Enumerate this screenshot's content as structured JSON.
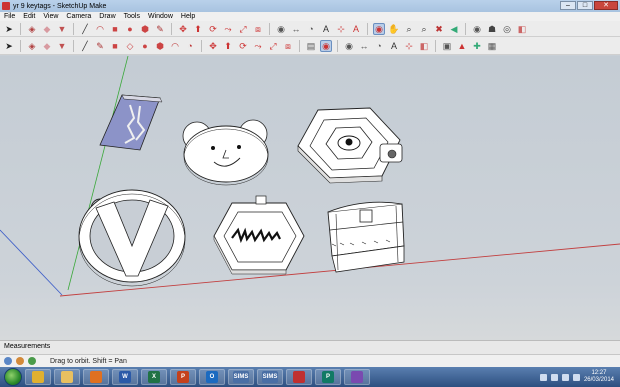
{
  "window": {
    "title": "yr 9 keytags - SketchUp Make"
  },
  "menu": [
    "File",
    "Edit",
    "View",
    "Camera",
    "Draw",
    "Tools",
    "Window",
    "Help"
  ],
  "toolbar1": [
    {
      "icon": "select-arrow-icon",
      "glyph": "➤",
      "color": "#222"
    },
    {
      "icon": "sep"
    },
    {
      "icon": "component-icon",
      "glyph": "◈",
      "color": "#b04040"
    },
    {
      "icon": "eraser-icon",
      "glyph": "◆",
      "color": "#d89aa0"
    },
    {
      "icon": "paint-bucket-icon",
      "glyph": "▼",
      "color": "#c05050"
    },
    {
      "icon": "sep"
    },
    {
      "icon": "line-icon",
      "glyph": "╱",
      "color": "#333"
    },
    {
      "icon": "arc-icon",
      "glyph": "◠",
      "color": "#b33"
    },
    {
      "icon": "rectangle-icon",
      "glyph": "■",
      "color": "#c44"
    },
    {
      "icon": "circle-icon",
      "glyph": "●",
      "color": "#c44"
    },
    {
      "icon": "polygon-icon",
      "glyph": "⬢",
      "color": "#c44"
    },
    {
      "icon": "freehand-icon",
      "glyph": "✎",
      "color": "#a33"
    },
    {
      "icon": "sep"
    },
    {
      "icon": "move-icon",
      "glyph": "✥",
      "color": "#c33"
    },
    {
      "icon": "push-pull-icon",
      "glyph": "⬆",
      "color": "#c33"
    },
    {
      "icon": "rotate-icon",
      "glyph": "⟳",
      "color": "#c33"
    },
    {
      "icon": "follow-me-icon",
      "glyph": "⤳",
      "color": "#c33"
    },
    {
      "icon": "scale-icon",
      "glyph": "⤢",
      "color": "#c33"
    },
    {
      "icon": "offset-icon",
      "glyph": "⧈",
      "color": "#c33"
    },
    {
      "icon": "sep"
    },
    {
      "icon": "tape-measure-icon",
      "glyph": "◉",
      "color": "#555"
    },
    {
      "icon": "dimension-icon",
      "glyph": "↔",
      "color": "#555"
    },
    {
      "icon": "protractor-icon",
      "glyph": "◔",
      "color": "#555"
    },
    {
      "icon": "text-icon",
      "glyph": "A",
      "color": "#333"
    },
    {
      "icon": "axes-icon",
      "glyph": "⊹",
      "color": "#c33"
    },
    {
      "icon": "3d-text-icon",
      "glyph": "A",
      "color": "#c33"
    },
    {
      "icon": "sep"
    },
    {
      "icon": "orbit-icon",
      "glyph": "◉",
      "color": "#c33",
      "active": true
    },
    {
      "icon": "pan-icon",
      "glyph": "✋",
      "color": "#444"
    },
    {
      "icon": "zoom-icon",
      "glyph": "⌕",
      "color": "#333"
    },
    {
      "icon": "zoom-window-icon",
      "glyph": "⌕",
      "color": "#333"
    },
    {
      "icon": "zoom-extents-icon",
      "glyph": "✖",
      "color": "#b33"
    },
    {
      "icon": "previous-view-icon",
      "glyph": "◀",
      "color": "#3a7"
    },
    {
      "icon": "sep"
    },
    {
      "icon": "position-camera-icon",
      "glyph": "◉",
      "color": "#555"
    },
    {
      "icon": "walk-icon",
      "glyph": "☗",
      "color": "#444"
    },
    {
      "icon": "look-around-icon",
      "glyph": "◎",
      "color": "#444"
    },
    {
      "icon": "section-plane-icon",
      "glyph": "◧",
      "color": "#c66"
    }
  ],
  "toolbar2": [
    {
      "icon": "select-arrow-icon",
      "glyph": "➤",
      "color": "#222"
    },
    {
      "icon": "sep"
    },
    {
      "icon": "component-icon",
      "glyph": "◈",
      "color": "#b04040"
    },
    {
      "icon": "eraser-icon",
      "glyph": "◆",
      "color": "#d89aa0"
    },
    {
      "icon": "paint-bucket-icon",
      "glyph": "▼",
      "color": "#c05050"
    },
    {
      "icon": "sep"
    },
    {
      "icon": "line-icon",
      "glyph": "╱",
      "color": "#333"
    },
    {
      "icon": "freehand-icon",
      "glyph": "✎",
      "color": "#a33"
    },
    {
      "icon": "rectangle-icon",
      "glyph": "■",
      "color": "#c44"
    },
    {
      "icon": "rotated-rectangle-icon",
      "glyph": "◇",
      "color": "#c44"
    },
    {
      "icon": "circle-icon",
      "glyph": "●",
      "color": "#c44"
    },
    {
      "icon": "polygon-icon",
      "glyph": "⬢",
      "color": "#c44"
    },
    {
      "icon": "arc-icon",
      "glyph": "◠",
      "color": "#b33"
    },
    {
      "icon": "pie-icon",
      "glyph": "◔",
      "color": "#b33"
    },
    {
      "icon": "sep"
    },
    {
      "icon": "move-icon",
      "glyph": "✥",
      "color": "#c33"
    },
    {
      "icon": "push-pull-icon",
      "glyph": "⬆",
      "color": "#c33"
    },
    {
      "icon": "rotate-icon",
      "glyph": "⟳",
      "color": "#c33"
    },
    {
      "icon": "follow-me-icon",
      "glyph": "⤳",
      "color": "#c33"
    },
    {
      "icon": "scale-icon",
      "glyph": "⤢",
      "color": "#c33"
    },
    {
      "icon": "offset-icon",
      "glyph": "⧈",
      "color": "#c33"
    },
    {
      "icon": "sep"
    },
    {
      "icon": "outliner-icon",
      "glyph": "▤",
      "color": "#555"
    },
    {
      "icon": "orbit-icon",
      "glyph": "◉",
      "color": "#c33",
      "active": true
    },
    {
      "icon": "sep"
    },
    {
      "icon": "tape-measure-icon",
      "glyph": "◉",
      "color": "#555"
    },
    {
      "icon": "dimension-icon",
      "glyph": "↔",
      "color": "#555"
    },
    {
      "icon": "protractor-icon",
      "glyph": "◔",
      "color": "#555"
    },
    {
      "icon": "text-icon",
      "glyph": "A",
      "color": "#333"
    },
    {
      "icon": "axes-icon",
      "glyph": "⊹",
      "color": "#c33"
    },
    {
      "icon": "section-plane-icon",
      "glyph": "◧",
      "color": "#c66"
    },
    {
      "icon": "sep"
    },
    {
      "icon": "get-models-icon",
      "glyph": "▣",
      "color": "#555"
    },
    {
      "icon": "share-model-icon",
      "glyph": "▲",
      "color": "#c33"
    },
    {
      "icon": "extension-warehouse-icon",
      "glyph": "✚",
      "color": "#3a7"
    },
    {
      "icon": "layers-icon",
      "glyph": "▦",
      "color": "#555"
    }
  ],
  "measurements": {
    "label": "Measurements"
  },
  "status": {
    "hint": "Drag to orbit.  Shift = Pan"
  },
  "taskbar": {
    "apps": [
      {
        "icon": "chrome-icon",
        "label": ""
      },
      {
        "icon": "explorer-icon",
        "label": ""
      },
      {
        "icon": "media-player-icon",
        "label": ""
      },
      {
        "icon": "word-icon",
        "label": "W"
      },
      {
        "icon": "excel-icon",
        "label": "X"
      },
      {
        "icon": "powerpoint-icon",
        "label": "P"
      },
      {
        "icon": "outlook-icon",
        "label": "O"
      },
      {
        "icon": "sims-icon",
        "label": "SIMS"
      },
      {
        "icon": "sims-icon",
        "label": "SIMS"
      },
      {
        "icon": "sketchup-icon",
        "label": ""
      },
      {
        "icon": "publisher-icon",
        "label": "P"
      },
      {
        "icon": "app-icon",
        "label": ""
      }
    ],
    "time": "12:27",
    "date": "26/03/2014"
  }
}
